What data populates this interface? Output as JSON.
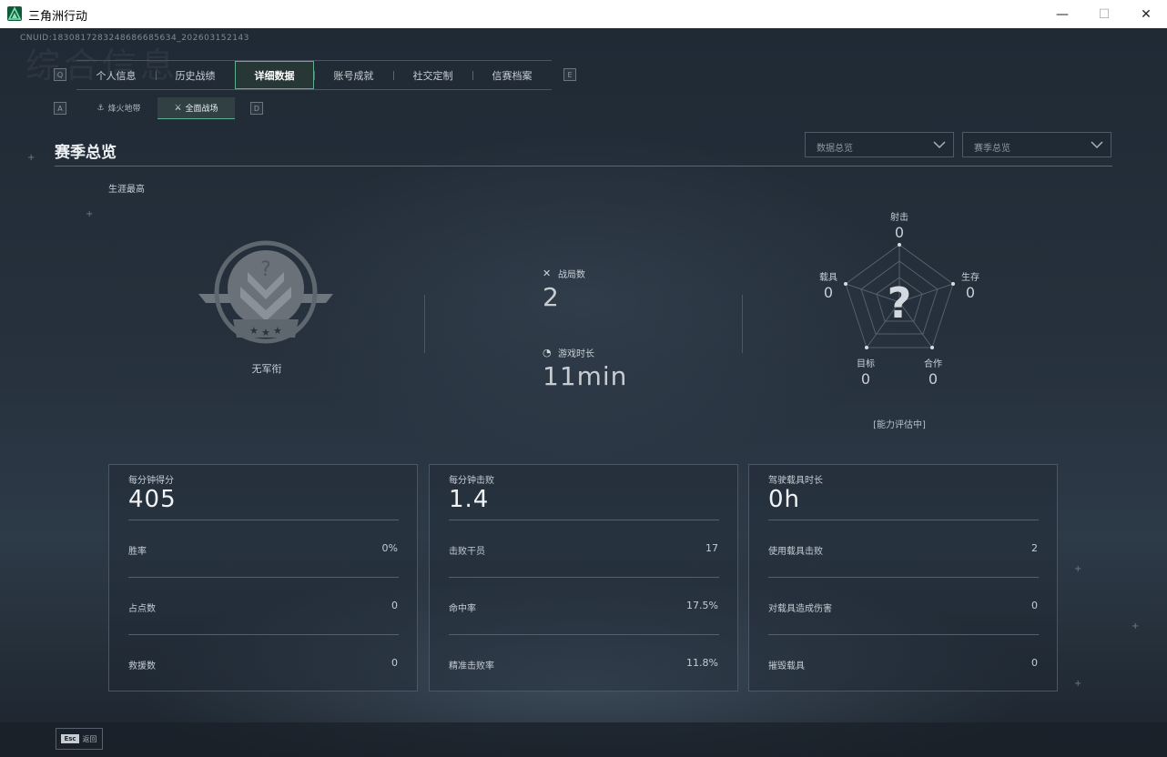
{
  "window": {
    "title": "三角洲行动",
    "min": "—",
    "max": "☐",
    "close": "✕"
  },
  "background_title": "综合信息",
  "uid": "CNUID:1830817283248686685634_202603152143",
  "tab_keys": {
    "left": "Q",
    "right": "E"
  },
  "tabs": [
    {
      "label": "个人信息"
    },
    {
      "label": "历史战绩"
    },
    {
      "label": "详细数据"
    },
    {
      "label": "账号成就"
    },
    {
      "label": "社交定制"
    },
    {
      "label": "信赛档案"
    }
  ],
  "subtab_keys": {
    "left": "A",
    "right": "D"
  },
  "subtabs": [
    {
      "label": "烽火地带",
      "icon": "⚓"
    },
    {
      "label": "全面战场",
      "icon": "⚔"
    }
  ],
  "section": {
    "title": "赛季总览",
    "dropdown1": "数据总览",
    "dropdown2": "赛季总览"
  },
  "career": {
    "label": "生涯最高",
    "rank": "无军衔",
    "battles_label": "战局数",
    "battles_value": "2",
    "playtime_label": "游戏时长",
    "playtime_value": "11min"
  },
  "radar": {
    "shooting_label": "射击",
    "shooting_value": "0",
    "survival_label": "生存",
    "survival_value": "0",
    "coop_label": "合作",
    "coop_value": "0",
    "target_label": "目标",
    "target_value": "0",
    "vehicle_label": "载具",
    "vehicle_value": "0",
    "center_mark": "?",
    "note": "[能力评估中]"
  },
  "cards": [
    {
      "label": "每分钟得分",
      "value": "405",
      "rows": [
        {
          "label": "胜率",
          "value": "0%"
        },
        {
          "label": "占点数",
          "value": "0"
        },
        {
          "label": "救援数",
          "value": "0"
        }
      ]
    },
    {
      "label": "每分钟击败",
      "value": "1.4",
      "rows": [
        {
          "label": "击败干员",
          "value": "17"
        },
        {
          "label": "命中率",
          "value": "17.5%"
        },
        {
          "label": "精准击败率",
          "value": "11.8%"
        }
      ]
    },
    {
      "label": "驾驶载具时长",
      "value": "0h",
      "rows": [
        {
          "label": "使用载具击败",
          "value": "2"
        },
        {
          "label": "对载具造成伤害",
          "value": "0"
        },
        {
          "label": "摧毁载具",
          "value": "0"
        }
      ]
    }
  ],
  "footer": {
    "esc_key": "Esc",
    "back_label": "返回"
  }
}
